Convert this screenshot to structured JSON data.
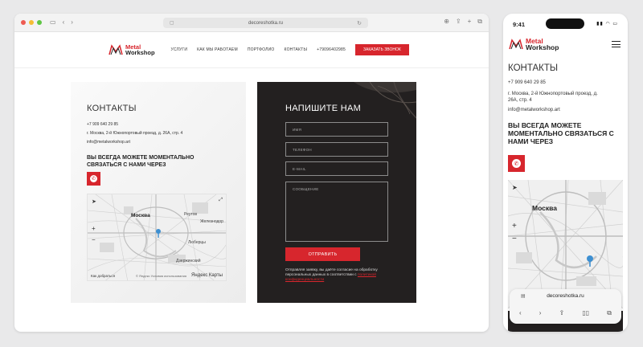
{
  "desktop": {
    "url": "decoreshotka.ru",
    "logo": {
      "line1": "Metal",
      "line2": "Workshop"
    },
    "nav": [
      "УСЛУГИ",
      "КАК МЫ РАБОТАЕМ",
      "ПОРТФОЛИО",
      "КОНТАКТЫ",
      "+79096402985"
    ],
    "cta": "ЗАКАЗАТЬ ЗВОНОК",
    "contacts": {
      "title": "КОНТАКТЫ",
      "phone": "+7 909 640 29 85",
      "address": "г. Москва, 2-й Южнопортовый проезд, д. 26А, стр. 4",
      "email": "info@metalworkshop.art",
      "messenger_heading": "ВЫ ВСЕГДА МОЖЕТЕ МОМЕНТАЛЬНО СВЯЗАТЬСЯ С НАМИ ЧЕРЕЗ"
    },
    "map": {
      "labels": [
        "Москва",
        "Реутов",
        "Железнодор",
        "Люберцы",
        "Дзержинский"
      ],
      "attribution": "Яндекс Карты",
      "bottom_left": "Как добраться",
      "bottom_terms": "© Яндекс Условия использования"
    },
    "form": {
      "title": "НАПИШИТЕ НАМ",
      "fields": [
        "ИМЯ",
        "ТЕЛЕФОН",
        "E-MAIL",
        "СООБЩЕНИЕ"
      ],
      "submit": "ОТПРАВИТЬ",
      "consent_text": "Отправляя заявку, вы даёте согласие на обработку персональных данных в соответствии с",
      "consent_link": "политикой конфиденциальности"
    }
  },
  "mobile": {
    "time": "9:41",
    "logo": {
      "line1": "Metal",
      "line2": "Workshop"
    },
    "title": "КОНТАКТЫ",
    "phone": "+7 909 640 29 85",
    "address": "г. Москва, 2-й Южнопортовый проезд, д. 26А, стр. 4",
    "email": "info@metalworkshop.art",
    "messenger_heading": "ВЫ ВСЕГДА МОЖЕТЕ МОМЕНТАЛЬНО СВЯЗАТЬСЯ С НАМИ ЧЕРЕЗ",
    "map_label": "Москва",
    "url": "decoreshotka.ru"
  },
  "colors": {
    "accent": "#d7262d",
    "dark": "#232020"
  },
  "icons": [
    "whatsapp-icon",
    "burger-menu-icon",
    "map-pin-icon"
  ]
}
